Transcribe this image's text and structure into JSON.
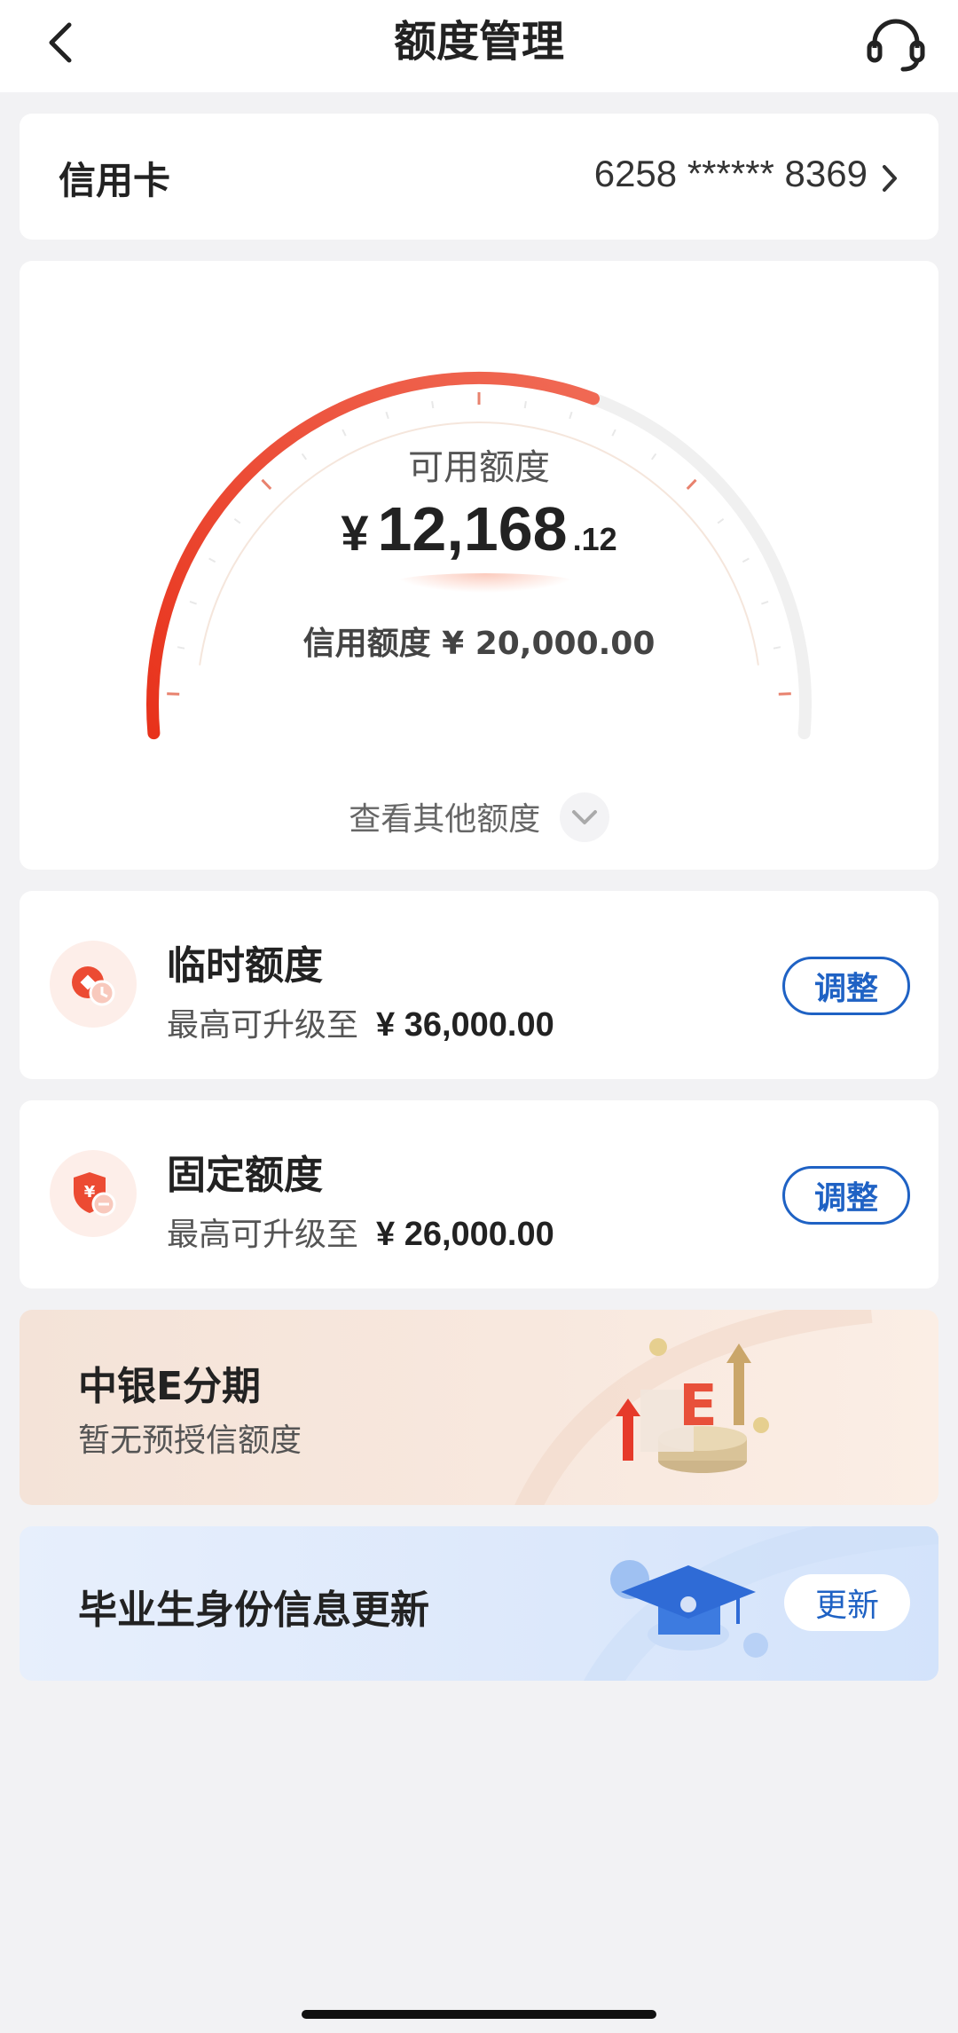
{
  "header": {
    "title": "额度管理"
  },
  "card_selector": {
    "label": "信用卡",
    "card_number": "6258 ****** 8369"
  },
  "gauge": {
    "available_label": "可用额度",
    "currency": "¥",
    "available_int": "12,168",
    "available_dec": ".12",
    "credit_line_text": "信用额度 ¥ 20,000.00",
    "more_limits_label": "查看其他额度",
    "used_fraction": 0.608,
    "colors": {
      "arc_start": "#e8321b",
      "arc_end": "#f06a55",
      "track": "#f0f0f0"
    }
  },
  "temp_limit": {
    "title": "临时额度",
    "sub_prefix": "最高可升级至",
    "amount": "¥ 36,000.00",
    "button": "调整"
  },
  "fixed_limit": {
    "title": "固定额度",
    "sub_prefix": "最高可升级至",
    "amount": "¥ 26,000.00",
    "button": "调整"
  },
  "installment_promo": {
    "title": "中银E分期",
    "subtitle": "暂无预授信额度",
    "icon_letter": "E"
  },
  "graduate_promo": {
    "title": "毕业生身份信息更新",
    "button": "更新"
  },
  "icons": [
    "back-arrow-icon",
    "headset-icon",
    "chevron-right-icon",
    "chevron-down-icon",
    "coin-clock-icon",
    "shield-yuan-icon",
    "installment-e-icon",
    "graduation-cap-icon"
  ],
  "accent": "#1f62c4"
}
